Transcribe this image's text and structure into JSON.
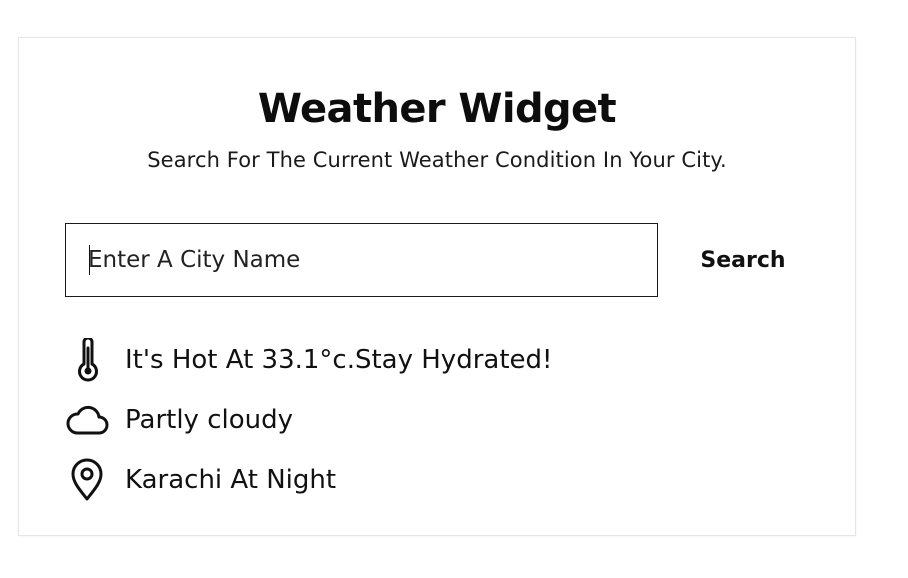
{
  "widget": {
    "title": "Weather Widget",
    "subtitle": "Search For The Current Weather Condition In Your City."
  },
  "search": {
    "placeholder": "Enter A City Name",
    "value": "",
    "button_label": "Search"
  },
  "results": {
    "temperature_text": "It's Hot At 33.1°c.Stay Hydrated!",
    "condition_text": "Partly cloudy",
    "location_text": "Karachi At Night"
  },
  "icons": {
    "temperature": "thermometer-icon",
    "condition": "cloud-icon",
    "location": "map-pin-icon"
  },
  "colors": {
    "text": "#111111",
    "border": "#1a1a1a",
    "card_border": "#e6e6e6",
    "background": "#ffffff"
  }
}
